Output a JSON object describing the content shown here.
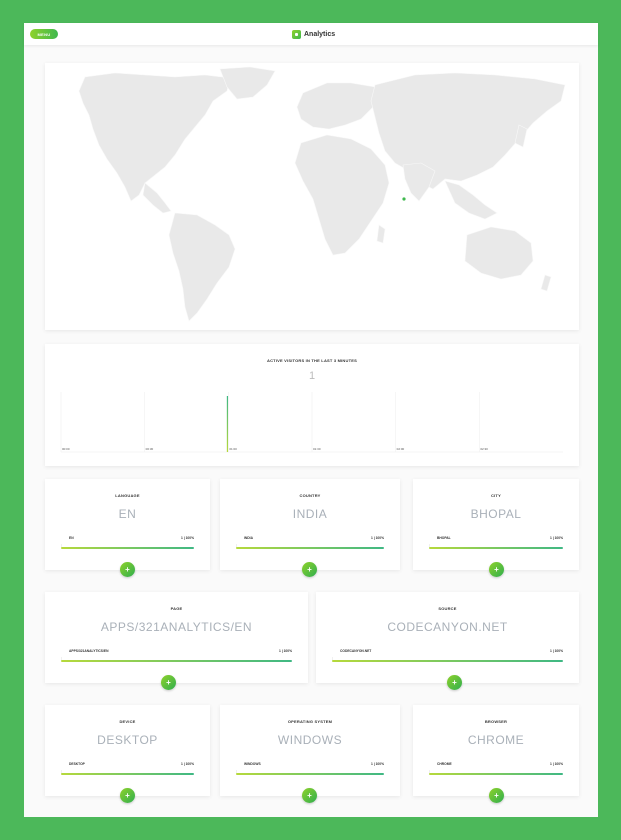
{
  "header": {
    "menu_label": "MENU",
    "brand": "Analytics",
    "logo_icon": "analytics-logo-icon"
  },
  "colors": {
    "accent_start": "#8fd22a",
    "accent_end": "#3fb84e",
    "background": "#4cb85a"
  },
  "map": {
    "highlight_country": "India"
  },
  "visitors": {
    "title": "ACTIVE VISITORS IN THE LAST 3 MINUTES",
    "count": "1",
    "chart_data": {
      "type": "bar",
      "categories": [
        "00:00",
        "00:30",
        "01:00",
        "01:30",
        "02:00",
        "02:30"
      ],
      "values": [
        0,
        1,
        0,
        0,
        0,
        0
      ],
      "title": "ACTIVE VISITORS IN THE LAST 3 MINUTES",
      "xlabel": "",
      "ylabel": "",
      "grid": true
    }
  },
  "stats": {
    "language": {
      "title": "LANGUAGE",
      "value": "EN",
      "row_label": "EN",
      "row_count": "1",
      "row_pct": "100%",
      "fill": 1.0
    },
    "country": {
      "title": "COUNTRY",
      "value": "INDIA",
      "row_label": "INDIA",
      "row_count": "1",
      "row_pct": "100%",
      "fill": 1.0
    },
    "city": {
      "title": "CITY",
      "value": "BHOPAL",
      "row_label": "BHOPAL",
      "row_count": "1",
      "row_pct": "100%",
      "fill": 1.0
    },
    "page": {
      "title": "PAGE",
      "value": "APPS/321ANALYTICS/EN",
      "row_label": "APPS/321ANALYTICS/EN",
      "row_count": "1",
      "row_pct": "100%",
      "fill": 1.0
    },
    "source": {
      "title": "SOURCE",
      "value": "CODECANYON.NET",
      "row_label": "CODECANYON.NET",
      "row_count": "1",
      "row_pct": "100%",
      "fill": 1.0
    },
    "device": {
      "title": "DEVICE",
      "value": "DESKTOP",
      "row_label": "DESKTOP",
      "row_count": "1",
      "row_pct": "100%",
      "fill": 1.0
    },
    "os": {
      "title": "OPERATING SYSTEM",
      "value": "WINDOWS",
      "row_label": "WINDOWS",
      "row_count": "1",
      "row_pct": "100%",
      "fill": 1.0
    },
    "browser": {
      "title": "BROWSER",
      "value": "CHROME",
      "row_label": "CHROME",
      "row_count": "1",
      "row_pct": "100%",
      "fill": 1.0
    }
  },
  "add_label": "+"
}
